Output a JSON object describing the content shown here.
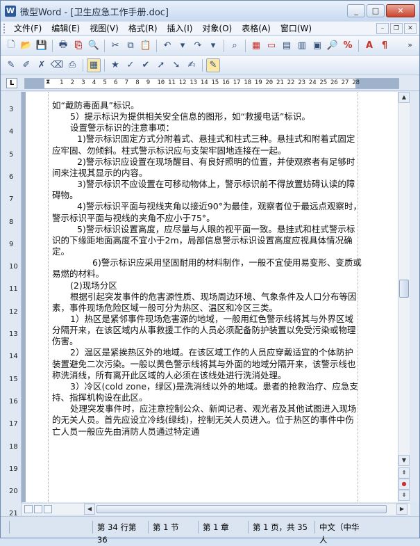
{
  "titlebar": {
    "app_icon_letter": "W",
    "title": "微型Word - [卫生应急工作手册.doc]",
    "minimize": "_",
    "maximize": "□",
    "close": "✕"
  },
  "menu": {
    "items": [
      "文件(F)",
      "编辑(E)",
      "视图(V)",
      "格式(R)",
      "插入(I)",
      "对象(O)",
      "表格(A)",
      "窗口(W)"
    ],
    "mdi_minimize": "–",
    "mdi_restore": "❐",
    "mdi_close": "✕"
  },
  "toolbar1": {
    "more": "»"
  },
  "ruler": {
    "corner": "L",
    "numbers": [
      "1",
      "2",
      "3",
      "4",
      "5",
      "6",
      "7",
      "8",
      "9",
      "10",
      "11",
      "12",
      "13",
      "14",
      "15",
      "16",
      "17",
      "18",
      "19",
      "20",
      "21",
      "22",
      "23",
      "24",
      "25",
      "26",
      "27",
      "28"
    ]
  },
  "vruler": {
    "numbers": [
      "3",
      "4",
      "5",
      "6",
      "7",
      "8",
      "9",
      "10",
      "11",
      "12",
      "13",
      "14",
      "15",
      "16",
      "17",
      "18",
      "19",
      "20",
      "21"
    ]
  },
  "document": {
    "paragraphs": [
      {
        "indent": "ind0",
        "text": "如“戴防毒面具”标识。"
      },
      {
        "indent": "ind1",
        "text": "5）提示标识为提供相关安全信息的图形，如“救援电话”标识。"
      },
      {
        "indent": "ind1",
        "text": "设置警示标识的注意事项："
      },
      {
        "indent": "ind2",
        "text": "1)警示标识固定方式分附着式、悬挂式和柱式三种。悬挂式和附着式固定应牢固、勿倾斜。柱式警示标识应与支架牢固地连接在一起。"
      },
      {
        "indent": "ind2",
        "text": "2)警示标识应设置在现场醒目、有良好照明的位置，并使观察者有足够时间来注视其显示的内容。"
      },
      {
        "indent": "ind2",
        "text": "3)警示标识不应设置在可移动物体上，警示标识前不得放置妨碍认读的障碍物。"
      },
      {
        "indent": "ind2",
        "text": "4)警示标识平面与视线夹角以接近90°为最佳，观察者位于最远点观察时，警示标识平面与视线的夹角不应小于75°。"
      },
      {
        "indent": "ind2",
        "text": "5)警示标识设置高度，应尽量与人眼的视平面一致。悬挂式和柱式警示标识的下缘距地面高度不宜小于2m，局部信息警示标识设置高度应视具体情况确定。"
      },
      {
        "indent": "ind3",
        "text": "6)警示标识应采用坚固耐用的材料制作，一般不宜使用易变形、变质或易燃的材料。"
      },
      {
        "indent": "ind1",
        "text": "(2)现场分区"
      },
      {
        "indent": "ind1",
        "text": "根据引起突发事件的危害源性质、现场周边环境、气象条件及人口分布等因素，事件现场危险区域一般可分为热区、温区和冷区三类。"
      },
      {
        "indent": "ind1",
        "text": "1）热区是紧邻事件现场危害源的地域，一般用红色警示线将其与外界区域分隔开来，在该区域内从事救援工作的人员必须配备防护装置以免受污染或物理伤害。"
      },
      {
        "indent": "ind1",
        "text": "2）温区是紧挨热区外的地域。在该区域工作的人员应穿戴适宜的个体防护装置避免二次污染。一般以黄色警示线将其与外面的地域分隔开来，该警示线也称洗消线，所有离开此区域的人必须在该线处进行洗消处理。"
      },
      {
        "indent": "ind1",
        "text": "3）冷区(cold zone，绿区)是洗消线以外的地域。患者的抢救治疗、应急支持、指挥机构设在此区。"
      },
      {
        "indent": "ind1",
        "text": "处理突发事件时，应注意控制公众、新闻记者、观光者及其他试图进入现场的无关人员。首先应设立冷线(绿线)，控制无关人员进入。位于热区的事件中伤亡人员一般应先由消防人员通过特定通"
      }
    ]
  },
  "statusbar": {
    "line": "第 34 行第 36",
    "section": "第 1 节",
    "chapter": "第 1 章",
    "page": "第 1 页，共 35",
    "language": "中文（中华人"
  }
}
